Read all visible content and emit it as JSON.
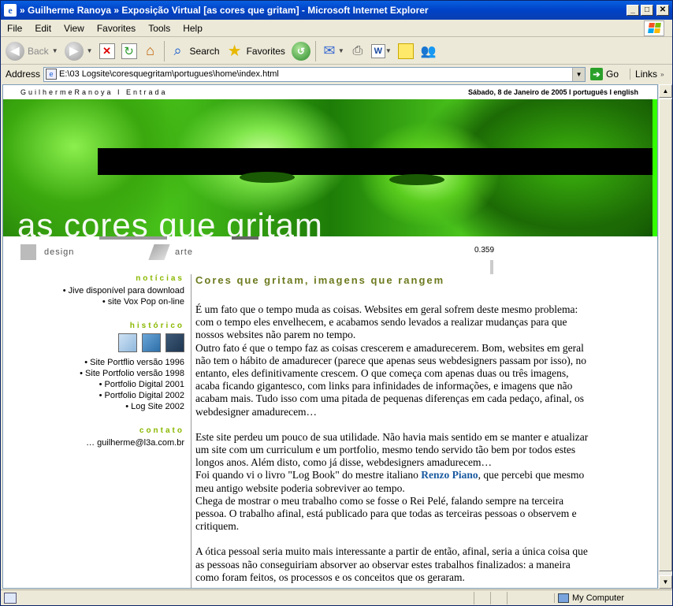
{
  "window": {
    "title": "» Guilherme Ranoya » Exposição Virtual [as cores que gritam] - Microsoft Internet Explorer",
    "ie_icon": "e",
    "minimize": "_",
    "maximize": "□",
    "close": "✕"
  },
  "menu": [
    "File",
    "Edit",
    "View",
    "Favorites",
    "Tools",
    "Help"
  ],
  "toolbar": {
    "back": "Back",
    "search": "Search",
    "favorites": "Favorites"
  },
  "address": {
    "label": "Address",
    "url": "E:\\03 Logsite\\coresquegritam\\portugues\\home\\index.html",
    "go": "Go",
    "links": "Links"
  },
  "site": {
    "brand": "GuilhermeRanoya I Entrada",
    "date": "Sábado, 8 de Janeiro de 2005 I português I english",
    "banner_title": "as cores que gritam",
    "nav": {
      "design": "design",
      "arte": "arte"
    },
    "counter": "0.359"
  },
  "sidebar": {
    "noticias_title": "notícias",
    "noticias": [
      "• Jive disponível para download",
      "• site Vox Pop on-line"
    ],
    "historico_title": "histórico",
    "historico": [
      "• Site Portflio versão 1996",
      "• Site Portfolio versão 1998",
      "• Portfolio Digital 2001",
      "• Portfolio Digital 2002",
      "• Log Site 2002"
    ],
    "contato_title": "contato",
    "contato": "… guilherme@l3a.com.br"
  },
  "article": {
    "headline": "Cores que gritam, imagens que rangem",
    "p1": "É um fato que o tempo muda as coisas. Websites em geral sofrem deste mesmo problema: com o tempo eles envelhecem, e acabamos sendo levados a realizar mudanças para que nossos websites não parem no tempo.",
    "p2": "Outro fato é que o tempo faz as coisas crescerem e amadurecerem. Bom, websites em geral não tem o hábito de amadurecer (parece que apenas seus webdesigners passam por isso), no entanto, eles definitivamente crescem. O que começa com apenas duas ou três imagens, acaba ficando gigantesco, com links para infinidades de informações, e imagens que não acabam mais. Tudo isso com uma pitada de pequenas diferenças em cada pedaço, afinal, os webdesigner amadurecem…",
    "p3": "Este site perdeu um pouco de sua utilidade. Não havia mais sentido em se manter e atualizar um site com um curriculum e um portfolio, mesmo tendo servido tão bem por todos estes longos anos. Além disto, como já disse, webdesigners amadurecem…",
    "p4_before": "Foi quando vi o livro \"Log Book\" do mestre italiano ",
    "p4_link": "Renzo Piano",
    "p4_after": ", que percebi que mesmo meu antigo website poderia sobreviver ao tempo.",
    "p5": "Chega de mostrar o meu trabalho como se fosse o Rei Pelé, falando sempre na terceira pessoa. O trabalho afinal, está publicado para que todas as terceiras pessoas o observem e critiquem.",
    "p6": "A ótica pessoal seria muito mais interessante a partir de então, afinal, seria a única coisa que as pessoas não conseguiriam absorver ao observar estes trabalhos finalizados: a maneira como foram feitos, os processos e os conceitos que os geraram."
  },
  "status": {
    "zone": "My Computer"
  },
  "colors": {
    "accent_green": "#8ab800",
    "headline": "#6d7a1e",
    "link": "#1a5aa0",
    "titlebar": "#0a5fe0"
  }
}
